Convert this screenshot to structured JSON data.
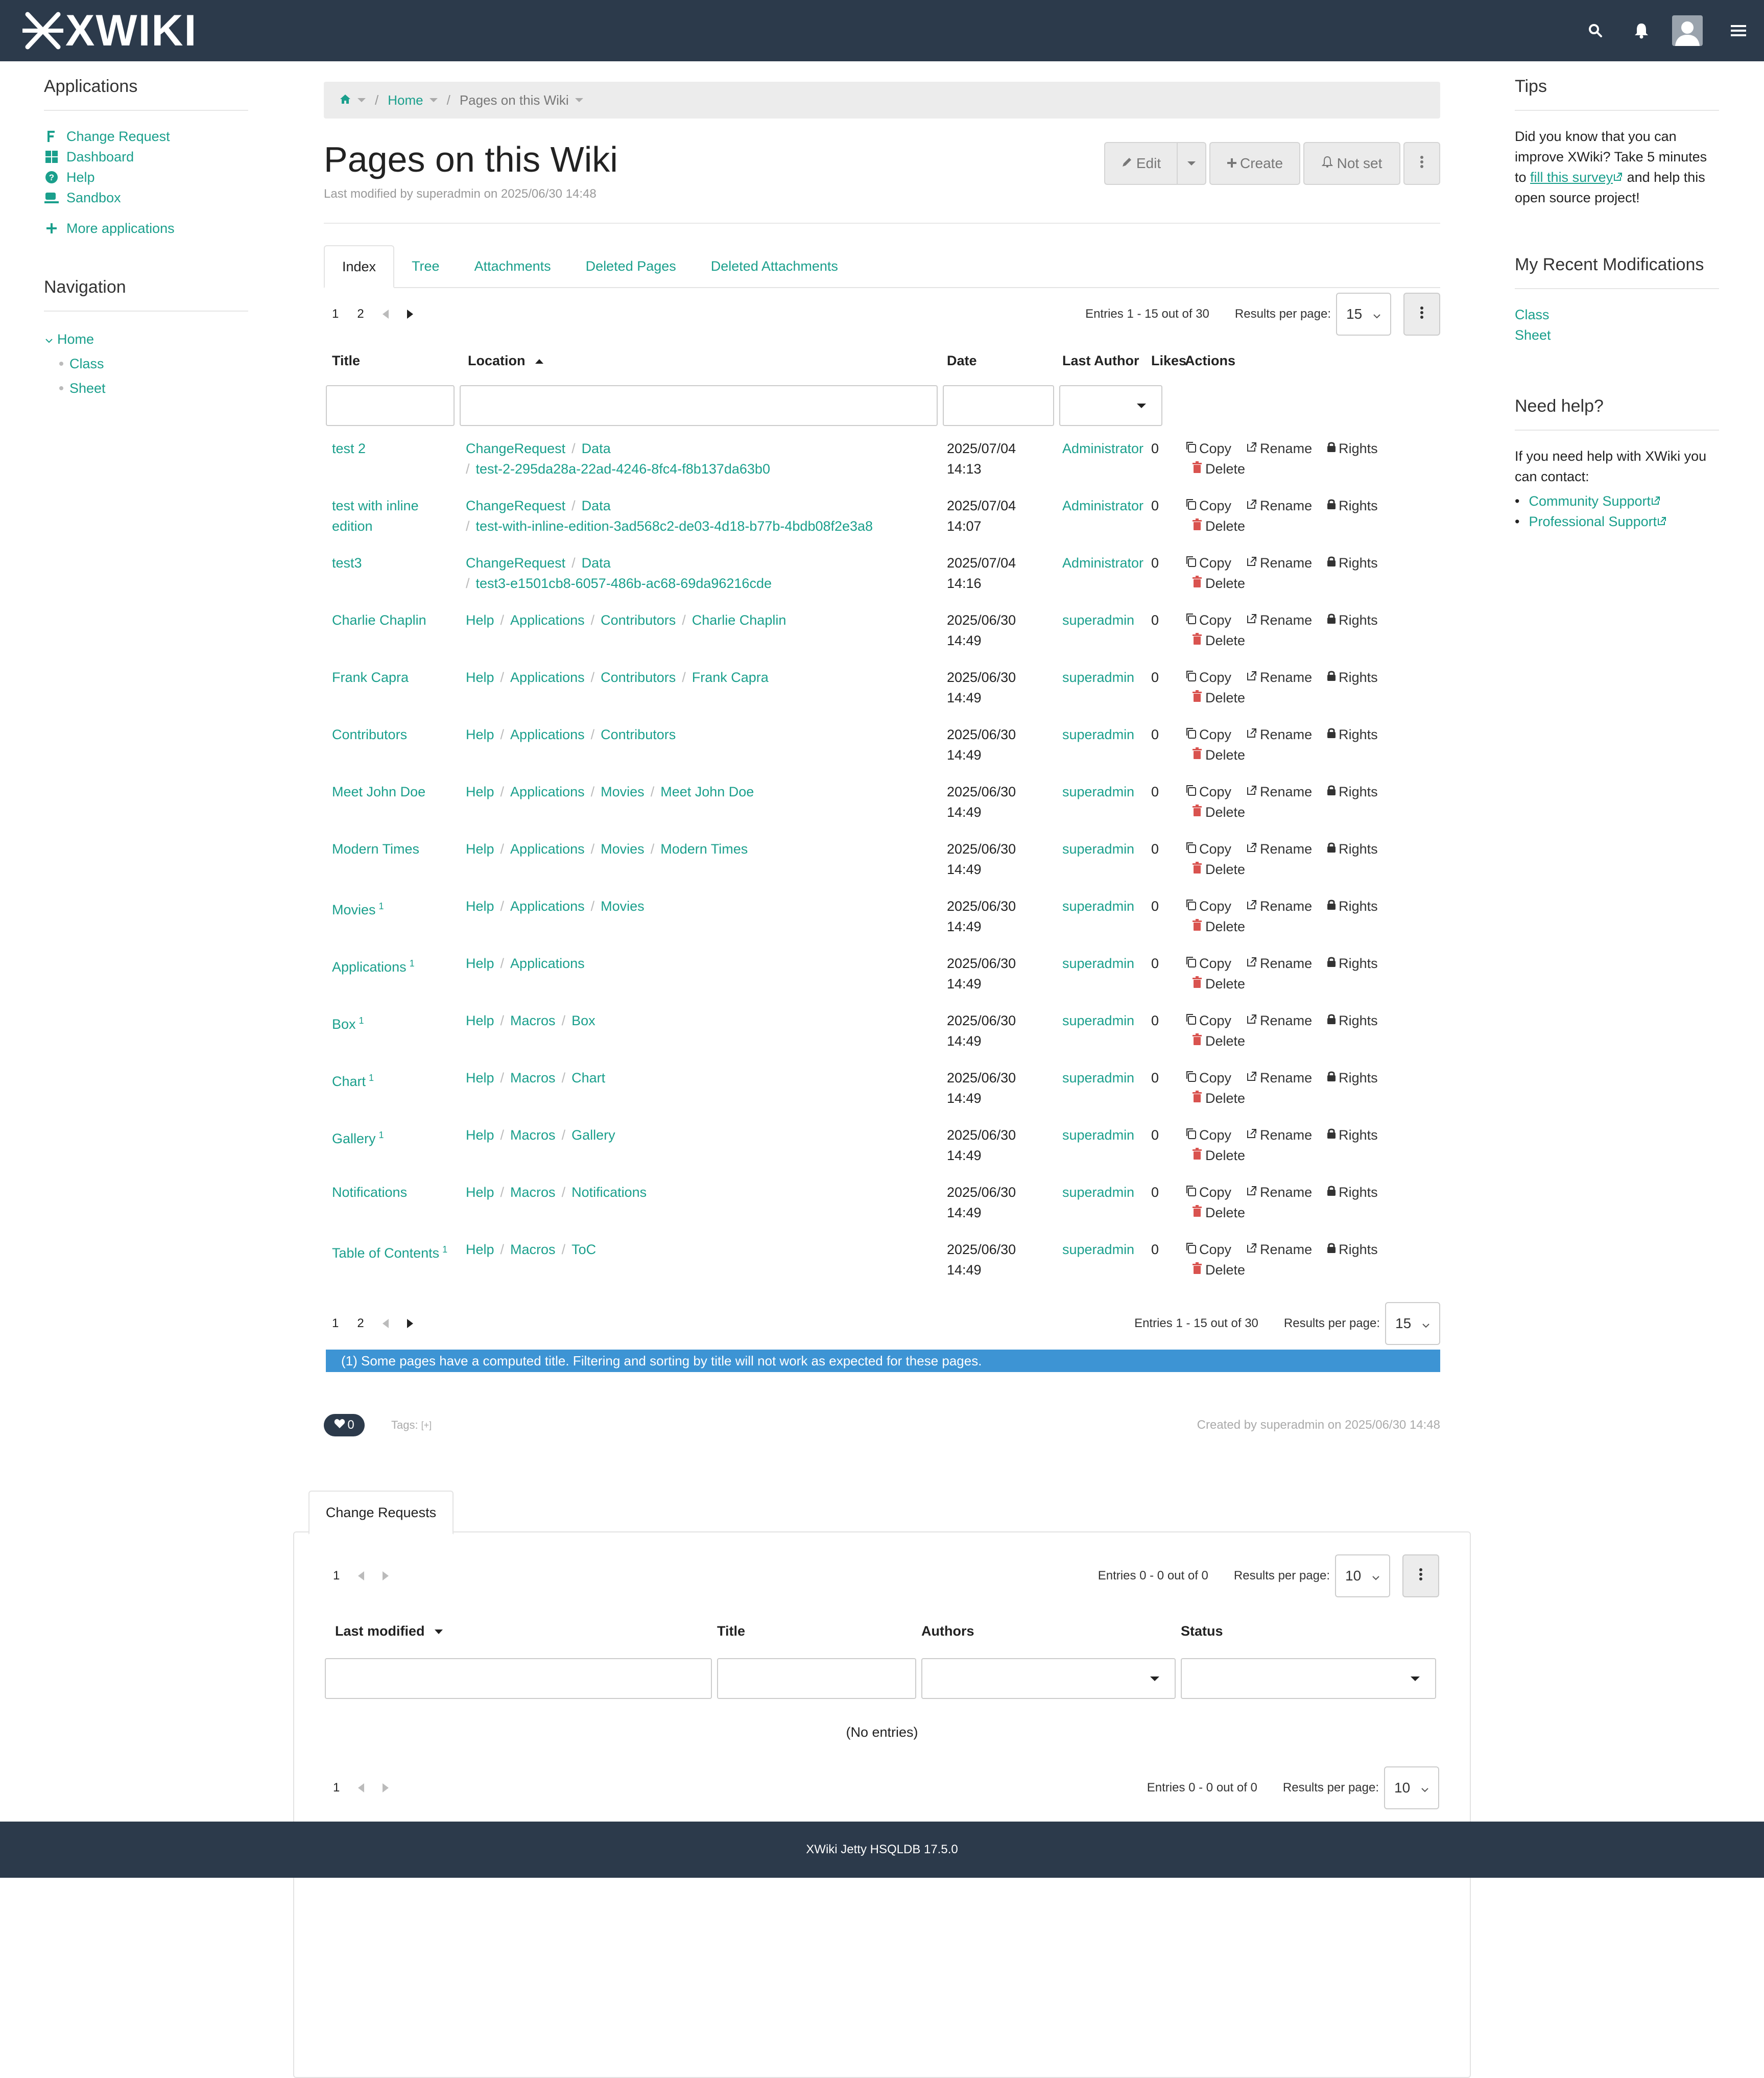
{
  "brand": {
    "logo_text": "XWIKI",
    "header_bg": "#2c3a4b",
    "link_color": "#1a9f8c",
    "note_bg": "#3d94d4"
  },
  "topbar": {
    "icons": [
      "search-icon",
      "bell-icon",
      "user-avatar",
      "menu-icon"
    ]
  },
  "applications": {
    "title": "Applications",
    "items": [
      {
        "label": "Change Request",
        "icon": "change-request-icon"
      },
      {
        "label": "Dashboard",
        "icon": "dashboard-icon"
      },
      {
        "label": "Help",
        "icon": "help-icon"
      },
      {
        "label": "Sandbox",
        "icon": "sandbox-icon"
      }
    ],
    "more": "More applications"
  },
  "navigation": {
    "title": "Navigation",
    "home": "Home",
    "children": [
      "Class",
      "Sheet"
    ]
  },
  "breadcrumb": {
    "home_icon": "home-icon",
    "items": [
      "Home",
      "Pages on this Wiki"
    ]
  },
  "page": {
    "title": "Pages on this Wiki",
    "modified": "Last modified by superadmin on 2025/06/30 14:48",
    "buttons": {
      "edit": "Edit",
      "create": "Create",
      "notify": "Not set"
    }
  },
  "tabs": [
    "Index",
    "Tree",
    "Attachments",
    "Deleted Pages",
    "Deleted Attachments"
  ],
  "pager": {
    "pages": [
      "1",
      "2"
    ],
    "entries": "Entries 1 - 15 out of 30",
    "rpp_label": "Results per page:",
    "rpp": "15"
  },
  "table": {
    "columns": [
      "Title",
      "Location",
      "Date",
      "Last Author",
      "Likes",
      "Actions"
    ],
    "actions": {
      "copy": "Copy",
      "rename": "Rename",
      "rights": "Rights",
      "delete": "Delete"
    },
    "rows": [
      {
        "title": "test 2",
        "sup": "",
        "loc": [
          "ChangeRequest",
          "Data"
        ],
        "loc2": "test-2-295da28a-22ad-4246-8fc4-f8b137da63b0",
        "date": "2025/07/04",
        "time": "14:13",
        "author": "Administrator",
        "likes": "0"
      },
      {
        "title": "test with inline edition",
        "sup": "",
        "loc": [
          "ChangeRequest",
          "Data"
        ],
        "loc2": "test-with-inline-edition-3ad568c2-de03-4d18-b77b-4bdb08f2e3a8",
        "date": "2025/07/04",
        "time": "14:07",
        "author": "Administrator",
        "likes": "0"
      },
      {
        "title": "test3",
        "sup": "",
        "loc": [
          "ChangeRequest",
          "Data"
        ],
        "loc2": "test3-e1501cb8-6057-486b-ac68-69da96216cde",
        "date": "2025/07/04",
        "time": "14:16",
        "author": "Administrator",
        "likes": "0"
      },
      {
        "title": "Charlie Chaplin",
        "sup": "",
        "loc": [
          "Help",
          "Applications",
          "Contributors",
          "Charlie Chaplin"
        ],
        "loc2": "",
        "date": "2025/06/30",
        "time": "14:49",
        "author": "superadmin",
        "likes": "0"
      },
      {
        "title": "Frank Capra",
        "sup": "",
        "loc": [
          "Help",
          "Applications",
          "Contributors",
          "Frank Capra"
        ],
        "loc2": "",
        "date": "2025/06/30",
        "time": "14:49",
        "author": "superadmin",
        "likes": "0"
      },
      {
        "title": "Contributors",
        "sup": "",
        "loc": [
          "Help",
          "Applications",
          "Contributors"
        ],
        "loc2": "",
        "date": "2025/06/30",
        "time": "14:49",
        "author": "superadmin",
        "likes": "0"
      },
      {
        "title": "Meet John Doe",
        "sup": "",
        "loc": [
          "Help",
          "Applications",
          "Movies",
          "Meet John Doe"
        ],
        "loc2": "",
        "date": "2025/06/30",
        "time": "14:49",
        "author": "superadmin",
        "likes": "0"
      },
      {
        "title": "Modern Times",
        "sup": "",
        "loc": [
          "Help",
          "Applications",
          "Movies",
          "Modern Times"
        ],
        "loc2": "",
        "date": "2025/06/30",
        "time": "14:49",
        "author": "superadmin",
        "likes": "0"
      },
      {
        "title": "Movies",
        "sup": "1",
        "loc": [
          "Help",
          "Applications",
          "Movies"
        ],
        "loc2": "",
        "date": "2025/06/30",
        "time": "14:49",
        "author": "superadmin",
        "likes": "0"
      },
      {
        "title": "Applications",
        "sup": "1",
        "loc": [
          "Help",
          "Applications"
        ],
        "loc2": "",
        "date": "2025/06/30",
        "time": "14:49",
        "author": "superadmin",
        "likes": "0"
      },
      {
        "title": "Box",
        "sup": "1",
        "loc": [
          "Help",
          "Macros",
          "Box"
        ],
        "loc2": "",
        "date": "2025/06/30",
        "time": "14:49",
        "author": "superadmin",
        "likes": "0"
      },
      {
        "title": "Chart",
        "sup": "1",
        "loc": [
          "Help",
          "Macros",
          "Chart"
        ],
        "loc2": "",
        "date": "2025/06/30",
        "time": "14:49",
        "author": "superadmin",
        "likes": "0"
      },
      {
        "title": "Gallery",
        "sup": "1",
        "loc": [
          "Help",
          "Macros",
          "Gallery"
        ],
        "loc2": "",
        "date": "2025/06/30",
        "time": "14:49",
        "author": "superadmin",
        "likes": "0"
      },
      {
        "title": "Notifications",
        "sup": "",
        "loc": [
          "Help",
          "Macros",
          "Notifications"
        ],
        "loc2": "",
        "date": "2025/06/30",
        "time": "14:49",
        "author": "superadmin",
        "likes": "0"
      },
      {
        "title": "Table of Contents",
        "sup": "1",
        "loc": [
          "Help",
          "Macros",
          "ToC"
        ],
        "loc2": "",
        "date": "2025/06/30",
        "time": "14:49",
        "author": "superadmin",
        "likes": "0"
      }
    ]
  },
  "note": "(1) Some pages have a computed title. Filtering and sorting by title will not work as expected for these pages.",
  "likes": {
    "count": "0",
    "tags_label": "Tags:",
    "tags_add": "[+]",
    "created": "Created by superadmin on 2025/06/30 14:48"
  },
  "change_requests": {
    "tab": "Change Requests",
    "pager": {
      "page": "1",
      "entries": "Entries 0 - 0 out of 0",
      "rpp_label": "Results per page:",
      "rpp": "10"
    },
    "columns": [
      "Last modified",
      "Title",
      "Authors",
      "Status"
    ],
    "empty": "(No entries)"
  },
  "tips": {
    "title": "Tips",
    "text1": "Did you know that you can improve XWiki? Take 5 minutes to",
    "link": "fill this survey",
    "text2": "and help this open source project!"
  },
  "recent": {
    "title": "My Recent Modifications",
    "items": [
      "Class",
      "Sheet"
    ]
  },
  "help": {
    "title": "Need help?",
    "text": "If you need help with XWiki you can contact:",
    "items": [
      "Community Support",
      "Professional Support"
    ]
  },
  "footer": "XWiki Jetty HSQLDB 17.5.0"
}
